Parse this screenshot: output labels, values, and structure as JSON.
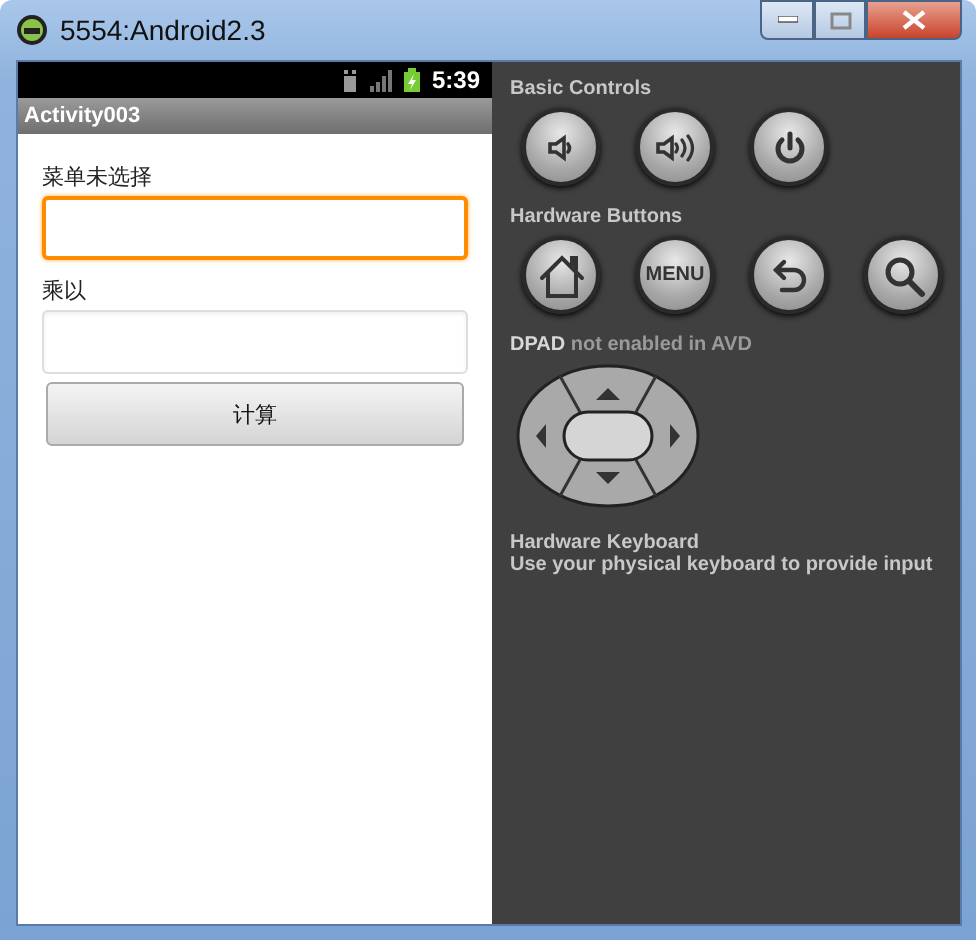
{
  "window": {
    "title": "5554:Android2.3"
  },
  "status_bar": {
    "time": "5:39"
  },
  "app_bar": {
    "title": "Activity003"
  },
  "form": {
    "fields": [
      {
        "label": "菜单未选择",
        "focused": true
      },
      {
        "label": "乘以",
        "focused": false
      }
    ],
    "button": "计算"
  },
  "basic_controls": {
    "title": "Basic Controls",
    "buttons": [
      {
        "kind": "volume-down"
      },
      {
        "kind": "volume-up"
      },
      {
        "kind": "power"
      }
    ]
  },
  "hardware_buttons": {
    "title": "Hardware Buttons",
    "buttons": [
      {
        "kind": "home"
      },
      {
        "kind": "menu",
        "label": "MENU"
      },
      {
        "kind": "back"
      },
      {
        "kind": "search"
      }
    ]
  },
  "dpad": {
    "caption": "**DPAD** not enabled in AVD"
  },
  "keyboard": {
    "title": "Hardware Keyboard",
    "description": "Use your physical keyboard to provide input"
  }
}
